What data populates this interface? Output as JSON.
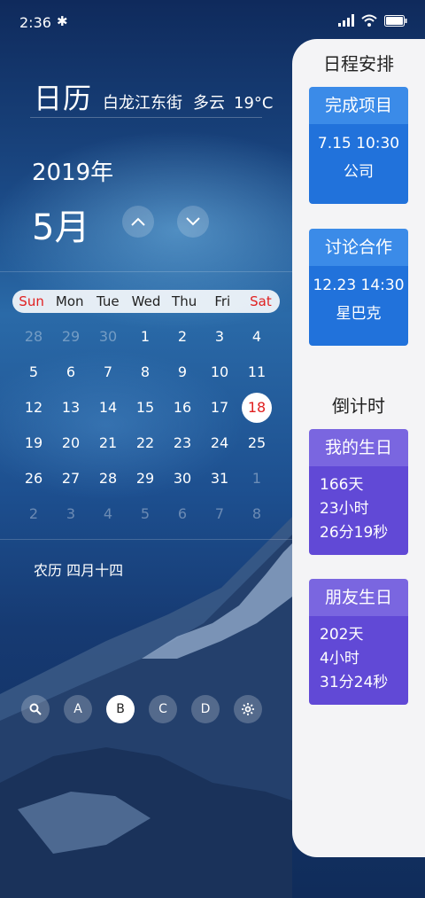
{
  "status": {
    "time": "2:36"
  },
  "header": {
    "app_title": "日历",
    "location": "白龙江东街",
    "weather": "多云",
    "temperature": "19°C"
  },
  "calendar": {
    "year": "2019年",
    "month": "5月",
    "weekdays": [
      "Sun",
      "Mon",
      "Tue",
      "Wed",
      "Thu",
      "Fri",
      "Sat"
    ],
    "weeks": [
      [
        "28",
        "29",
        "30",
        "1",
        "2",
        "3",
        "4"
      ],
      [
        "5",
        "6",
        "7",
        "8",
        "9",
        "10",
        "11"
      ],
      [
        "12",
        "13",
        "14",
        "15",
        "16",
        "17",
        "18"
      ],
      [
        "19",
        "20",
        "21",
        "22",
        "23",
        "24",
        "25"
      ],
      [
        "26",
        "27",
        "28",
        "29",
        "30",
        "31",
        "1"
      ],
      [
        "2",
        "3",
        "4",
        "5",
        "6",
        "7",
        "8"
      ]
    ],
    "today": "18",
    "lunar": "农历  四月十四"
  },
  "toolbar": {
    "a": "A",
    "b": "B",
    "c": "C",
    "d": "D"
  },
  "panel": {
    "title": "日程安排",
    "events": [
      {
        "title": "完成项目",
        "datetime": "7.15  10:30",
        "place": "公司"
      },
      {
        "title": "讨论合作",
        "datetime": "12.23  14:30",
        "place": "星巴克"
      }
    ],
    "countdown_title": "倒计时",
    "countdowns": [
      {
        "title": "我的生日",
        "days": "166天",
        "hours": "23小时",
        "minsec": "26分19秒"
      },
      {
        "title": "朋友生日",
        "days": "202天",
        "hours": "4小时",
        "minsec": "31分24秒"
      }
    ]
  }
}
